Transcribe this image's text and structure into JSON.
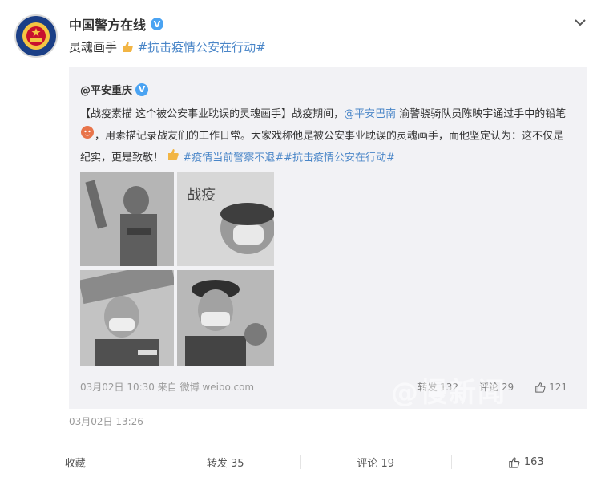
{
  "post": {
    "author": "中国警方在线",
    "text": "灵魂画手",
    "hashtag": "#抗击疫情公安在行动#",
    "time": "03月02日 13:26"
  },
  "repost": {
    "author": "@平安重庆",
    "body_part1": "【战疫素描 这个被公安事业耽误的灵魂画手】战疫期间，",
    "mention": "@平安巴南",
    "body_part2": " 渝警骁骑队员陈映宇通过手中的铅笔",
    "body_part3": "，用素描记录战友们的工作日常。大家戏称他是被公安事业耽误的灵魂画手，而他坚定认为：这不仅是纪实，更是致敬！",
    "hashtags": "#疫情当前警察不退##抗击疫情公安在行动#",
    "photo_caption": "战疫",
    "meta": "03月02日 10:30 来自 微博 weibo.com",
    "repost_label": "转发 132",
    "comment_label": "评论 29",
    "like_count": "121"
  },
  "footer": {
    "collect": "收藏",
    "repost": "转发 35",
    "comment": "评论 19",
    "like": "163"
  },
  "watermark": "@慢新闻",
  "colors": {
    "link": "#4a86c8",
    "mention": "#e0483c",
    "badge": "#4aa3f2",
    "repost_bg": "#f2f2f5"
  }
}
